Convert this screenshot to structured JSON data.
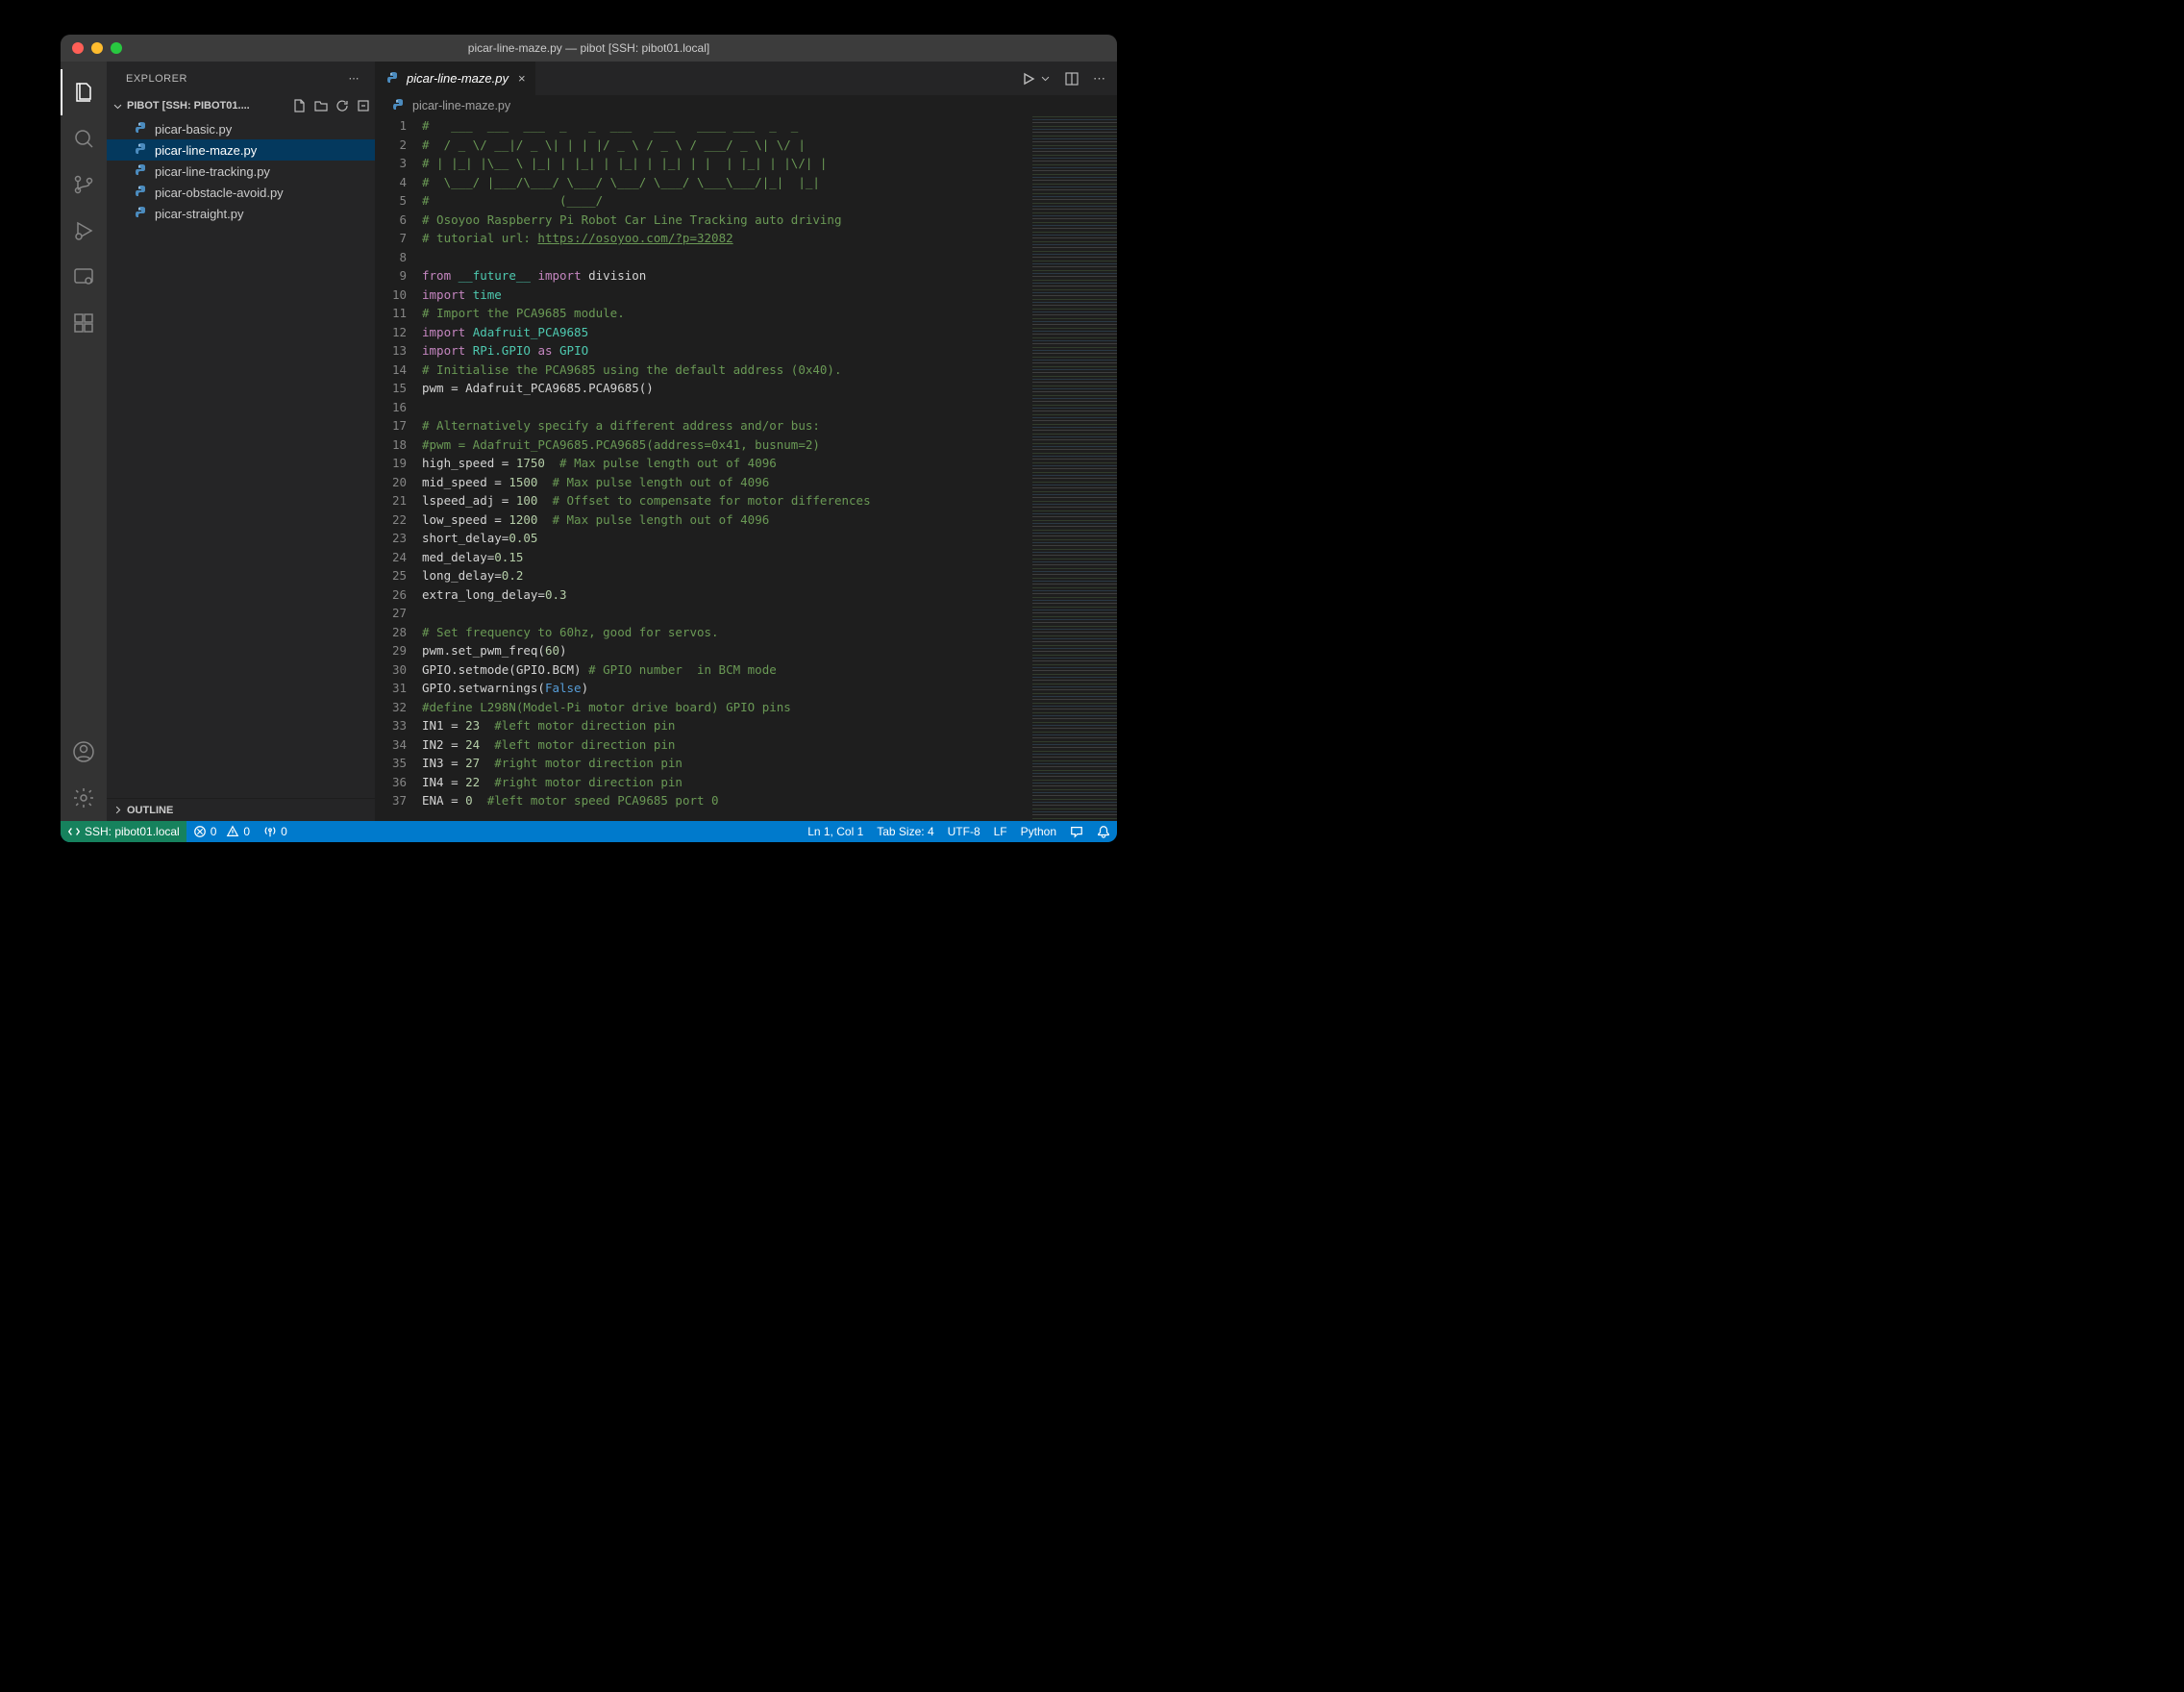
{
  "title": "picar-line-maze.py — pibot [SSH: pibot01.local]",
  "explorer": {
    "label": "EXPLORER",
    "folder": "PIBOT [SSH: PIBOT01....",
    "files": [
      "picar-basic.py",
      "picar-line-maze.py",
      "picar-line-tracking.py",
      "picar-obstacle-avoid.py",
      "picar-straight.py"
    ],
    "active_index": 1,
    "outline": "OUTLINE"
  },
  "tab": {
    "label": "picar-line-maze.py"
  },
  "breadcrumb": "picar-line-maze.py",
  "code_lines": [
    [
      {
        "t": "c-comment",
        "s": "#   ___  ___  ___  _   _  ___   ___   ____ ___  _  _"
      }
    ],
    [
      {
        "t": "c-comment",
        "s": "#  / _ \\\\/ __|/ _ \\\\| | | |/ _ \\\\ / _ \\\\ / ___/ _ \\\\| \\\\/ |"
      }
    ],
    [
      {
        "t": "c-comment",
        "s": "# | |_| |\\\\__ \\\\ |_| | |_| | |_| | |_| | |  | |_| | |\\\\/| |"
      }
    ],
    [
      {
        "t": "c-comment",
        "s": "#  \\\\___/ |___/\\\\___/ \\\\___/ \\\\___/ \\\\___/ \\\\___\\\\___/|_|  |_|"
      }
    ],
    [
      {
        "t": "c-comment",
        "s": "#                  (____/"
      }
    ],
    [
      {
        "t": "c-comment",
        "s": "# Osoyoo Raspberry Pi Robot Car Line Tracking auto driving"
      }
    ],
    [
      {
        "t": "c-comment",
        "s": "# tutorial url: "
      },
      {
        "t": "c-comment c-under",
        "s": "https://osoyoo.com/?p=32082"
      }
    ],
    [
      {
        "t": "",
        "s": ""
      }
    ],
    [
      {
        "t": "c-keyword",
        "s": "from"
      },
      {
        "t": "",
        "s": " "
      },
      {
        "t": "c-module",
        "s": "__future__"
      },
      {
        "t": "",
        "s": " "
      },
      {
        "t": "c-keyword",
        "s": "import"
      },
      {
        "t": "",
        "s": " division"
      }
    ],
    [
      {
        "t": "c-keyword",
        "s": "import"
      },
      {
        "t": "",
        "s": " "
      },
      {
        "t": "c-module",
        "s": "time"
      }
    ],
    [
      {
        "t": "c-comment",
        "s": "# Import the PCA9685 module."
      }
    ],
    [
      {
        "t": "c-keyword",
        "s": "import"
      },
      {
        "t": "",
        "s": " "
      },
      {
        "t": "c-module",
        "s": "Adafruit_PCA9685"
      }
    ],
    [
      {
        "t": "c-keyword",
        "s": "import"
      },
      {
        "t": "",
        "s": " "
      },
      {
        "t": "c-module",
        "s": "RPi.GPIO"
      },
      {
        "t": "",
        "s": " "
      },
      {
        "t": "c-keyword",
        "s": "as"
      },
      {
        "t": "",
        "s": " "
      },
      {
        "t": "c-module",
        "s": "GPIO"
      }
    ],
    [
      {
        "t": "c-comment",
        "s": "# Initialise the PCA9685 using the default address (0x40)."
      }
    ],
    [
      {
        "t": "",
        "s": "pwm = Adafruit_PCA9685.PCA9685()"
      }
    ],
    [
      {
        "t": "",
        "s": ""
      }
    ],
    [
      {
        "t": "c-comment",
        "s": "# Alternatively specify a different address and/or bus:"
      }
    ],
    [
      {
        "t": "c-comment",
        "s": "#pwm = Adafruit_PCA9685.PCA9685(address=0x41, busnum=2)"
      }
    ],
    [
      {
        "t": "",
        "s": "high_speed = "
      },
      {
        "t": "c-num",
        "s": "1750"
      },
      {
        "t": "",
        "s": "  "
      },
      {
        "t": "c-comment",
        "s": "# Max pulse length out of 4096"
      }
    ],
    [
      {
        "t": "",
        "s": "mid_speed = "
      },
      {
        "t": "c-num",
        "s": "1500"
      },
      {
        "t": "",
        "s": "  "
      },
      {
        "t": "c-comment",
        "s": "# Max pulse length out of 4096"
      }
    ],
    [
      {
        "t": "",
        "s": "lspeed_adj = "
      },
      {
        "t": "c-num",
        "s": "100"
      },
      {
        "t": "",
        "s": "  "
      },
      {
        "t": "c-comment",
        "s": "# Offset to compensate for motor differences"
      }
    ],
    [
      {
        "t": "",
        "s": "low_speed = "
      },
      {
        "t": "c-num",
        "s": "1200"
      },
      {
        "t": "",
        "s": "  "
      },
      {
        "t": "c-comment",
        "s": "# Max pulse length out of 4096"
      }
    ],
    [
      {
        "t": "",
        "s": "short_delay="
      },
      {
        "t": "c-num",
        "s": "0.05"
      }
    ],
    [
      {
        "t": "",
        "s": "med_delay="
      },
      {
        "t": "c-num",
        "s": "0.15"
      }
    ],
    [
      {
        "t": "",
        "s": "long_delay="
      },
      {
        "t": "c-num",
        "s": "0.2"
      }
    ],
    [
      {
        "t": "",
        "s": "extra_long_delay="
      },
      {
        "t": "c-num",
        "s": "0.3"
      }
    ],
    [
      {
        "t": "",
        "s": ""
      }
    ],
    [
      {
        "t": "c-comment",
        "s": "# Set frequency to 60hz, good for servos."
      }
    ],
    [
      {
        "t": "",
        "s": "pwm.set_pwm_freq("
      },
      {
        "t": "c-num",
        "s": "60"
      },
      {
        "t": "",
        "s": ")"
      }
    ],
    [
      {
        "t": "",
        "s": "GPIO.setmode(GPIO.BCM) "
      },
      {
        "t": "c-comment",
        "s": "# GPIO number  in BCM mode"
      }
    ],
    [
      {
        "t": "",
        "s": "GPIO.setwarnings("
      },
      {
        "t": "c-const",
        "s": "False"
      },
      {
        "t": "",
        "s": ")"
      }
    ],
    [
      {
        "t": "c-comment",
        "s": "#define L298N(Model-Pi motor drive board) GPIO pins"
      }
    ],
    [
      {
        "t": "",
        "s": "IN1 = "
      },
      {
        "t": "c-num",
        "s": "23"
      },
      {
        "t": "",
        "s": "  "
      },
      {
        "t": "c-comment",
        "s": "#left motor direction pin"
      }
    ],
    [
      {
        "t": "",
        "s": "IN2 = "
      },
      {
        "t": "c-num",
        "s": "24"
      },
      {
        "t": "",
        "s": "  "
      },
      {
        "t": "c-comment",
        "s": "#left motor direction pin"
      }
    ],
    [
      {
        "t": "",
        "s": "IN3 = "
      },
      {
        "t": "c-num",
        "s": "27"
      },
      {
        "t": "",
        "s": "  "
      },
      {
        "t": "c-comment",
        "s": "#right motor direction pin"
      }
    ],
    [
      {
        "t": "",
        "s": "IN4 = "
      },
      {
        "t": "c-num",
        "s": "22"
      },
      {
        "t": "",
        "s": "  "
      },
      {
        "t": "c-comment",
        "s": "#right motor direction pin"
      }
    ],
    [
      {
        "t": "",
        "s": "ENA = "
      },
      {
        "t": "c-num",
        "s": "0"
      },
      {
        "t": "",
        "s": "  "
      },
      {
        "t": "c-comment",
        "s": "#left motor speed PCA9685 port 0"
      }
    ]
  ],
  "status": {
    "remote": "SSH: pibot01.local",
    "errors": "0",
    "warnings": "0",
    "ports": "0",
    "ln_col": "Ln 1, Col 1",
    "tab_size": "Tab Size: 4",
    "encoding": "UTF-8",
    "eol": "LF",
    "language": "Python"
  }
}
